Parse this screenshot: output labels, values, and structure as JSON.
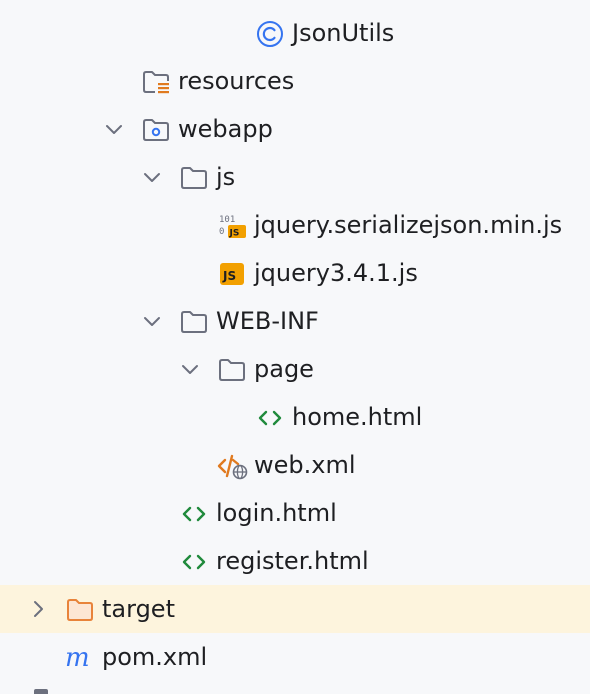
{
  "tree": {
    "items": [
      {
        "label": "JsonUtils",
        "icon": "class-icon"
      },
      {
        "label": "resources",
        "icon": "resources-folder-icon"
      },
      {
        "label": "webapp",
        "icon": "web-folder-icon",
        "expanded": true
      },
      {
        "label": "js",
        "icon": "folder-icon",
        "expanded": true
      },
      {
        "label": "jquery.serializejson.min.js",
        "icon": "minified-js-icon"
      },
      {
        "label": "jquery3.4.1.js",
        "icon": "javascript-file-icon"
      },
      {
        "label": "WEB-INF",
        "icon": "folder-icon",
        "expanded": true
      },
      {
        "label": "page",
        "icon": "folder-icon",
        "expanded": true
      },
      {
        "label": "home.html",
        "icon": "html-file-icon"
      },
      {
        "label": "web.xml",
        "icon": "web-xml-icon"
      },
      {
        "label": "login.html",
        "icon": "html-file-icon"
      },
      {
        "label": "register.html",
        "icon": "html-file-icon"
      },
      {
        "label": "target",
        "icon": "excluded-folder-icon",
        "expanded": false,
        "selected": true
      },
      {
        "label": "pom.xml",
        "icon": "maven-file-icon"
      }
    ]
  },
  "colors": {
    "background": "#f7f8fa",
    "highlight_row": "#fdf4dd",
    "class_icon": "#3574f0",
    "html_icon": "#208a3c",
    "js_badge": "#f2a000",
    "xml_icon": "#e07a1f",
    "excluded_folder": "#e8833a",
    "maven_icon": "#3574f0",
    "folder_outline": "#6c707e"
  }
}
